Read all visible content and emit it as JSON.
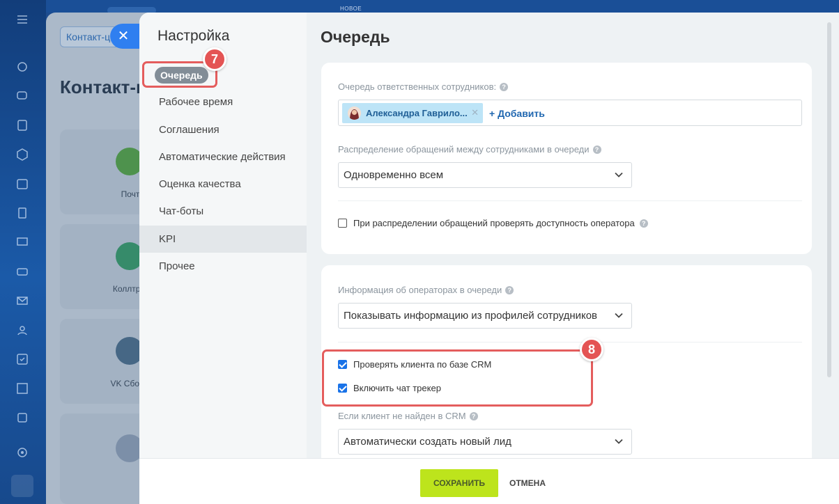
{
  "banner": {
    "new_label": "НОВОЕ"
  },
  "underlying_page": {
    "breadcrumb": "Контакт-ц",
    "title": "Контакт-це",
    "cards": [
      {
        "label": "Почт",
        "icon": "mail-icon",
        "color": "#57a346"
      },
      {
        "label": "Коллтре",
        "icon": "phone-icon",
        "color": "#3a9a6a"
      },
      {
        "label": "VK Сбор з",
        "icon": "form-icon",
        "color": "#4d6e8a"
      }
    ]
  },
  "settings": {
    "title": "Настройка",
    "menu": [
      {
        "label": "Очередь",
        "active": true
      },
      {
        "label": "Рабочее время"
      },
      {
        "label": "Соглашения"
      },
      {
        "label": "Автоматические действия"
      },
      {
        "label": "Оценка качества"
      },
      {
        "label": "Чат-боты"
      },
      {
        "label": "KPI"
      },
      {
        "label": "Прочее"
      }
    ]
  },
  "queue": {
    "title": "Очередь",
    "responsible_label": "Очередь ответственных сотрудников:",
    "user_name": "Александра Гаврило...",
    "add_label": "+ Добавить",
    "distribution_label": "Распределение обращений между сотрудниками в очереди",
    "distribution_value": "Одновременно всем",
    "check_availability_label": "При распределении обращений проверять доступность оператора",
    "operator_info_label": "Информация об операторах в очереди",
    "operator_info_value": "Показывать информацию из профилей сотрудников",
    "crm_check_label": "Проверять клиента по базе CRM",
    "chat_tracker_label": "Включить чат трекер",
    "not_found_label": "Если клиент не найден в CRM",
    "not_found_value": "Автоматически создать новый лид"
  },
  "callouts": {
    "step7": "7",
    "step8": "8"
  },
  "footer": {
    "save_label": "СОХРАНИТЬ",
    "cancel_label": "ОТМЕНА"
  },
  "colors": {
    "accent": "#2f7ff0",
    "save": "#bde41c",
    "callout": "#e45454"
  }
}
